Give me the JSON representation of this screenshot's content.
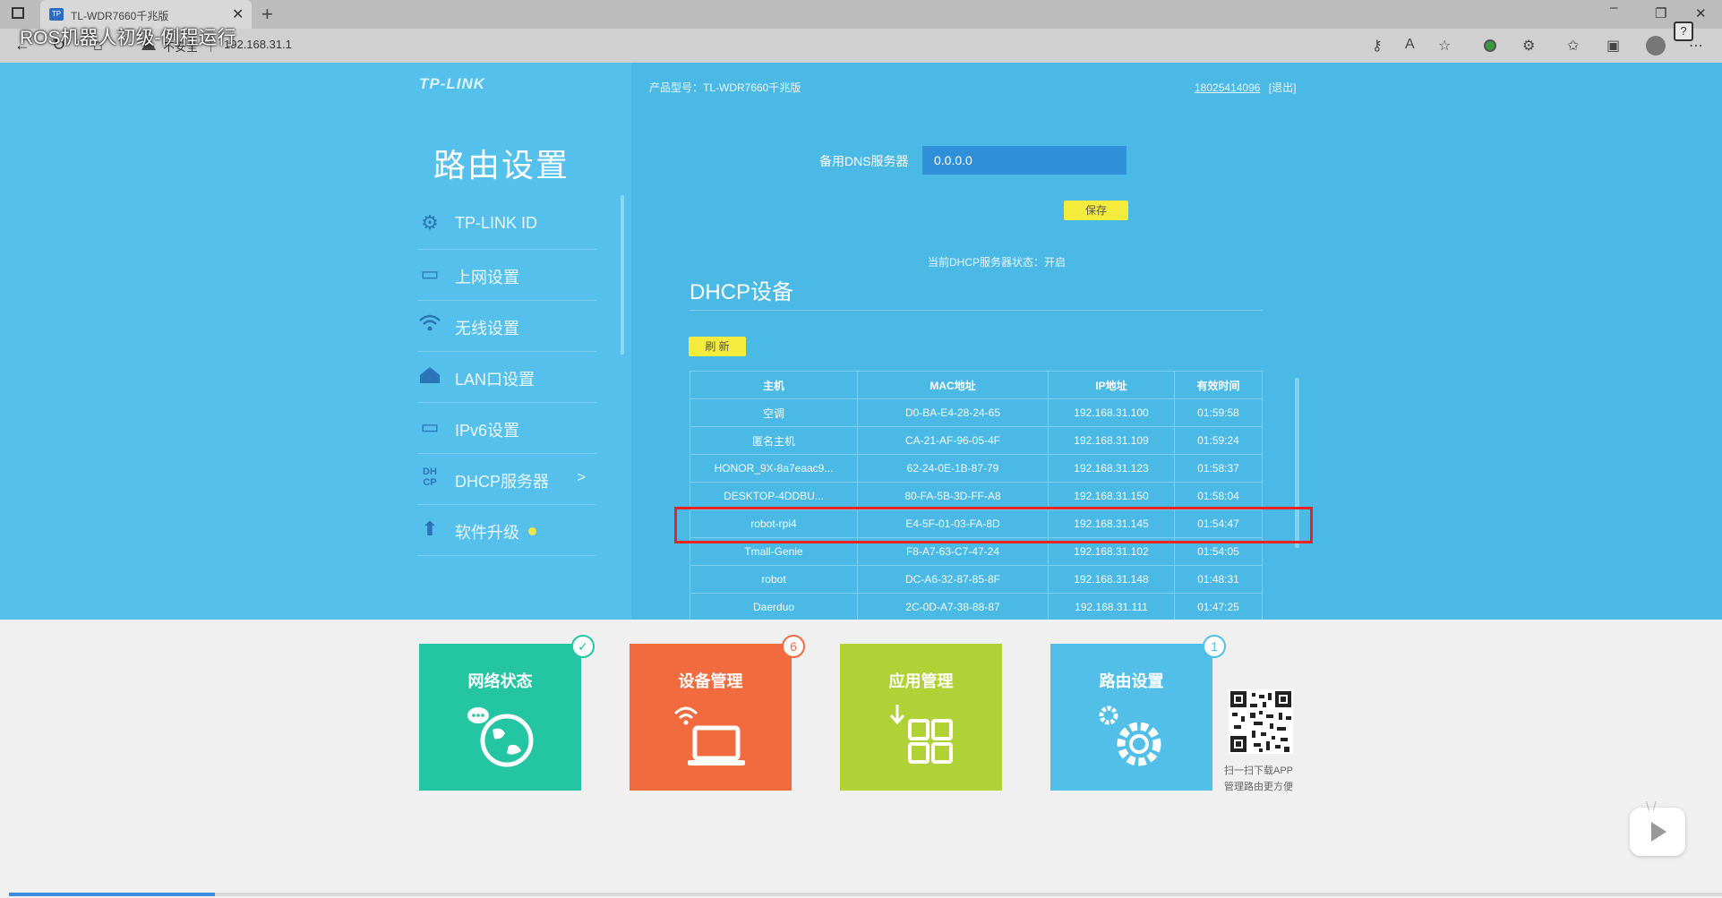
{
  "overlay_title": "ROS机器人初级-例程运行",
  "browser": {
    "tab_title": "TL-WDR7660千兆版",
    "tab_favicon": "TP",
    "tab_close": "✕",
    "new_tab": "+",
    "not_secure": "不安全",
    "url": "192.168.31.1",
    "help": "?"
  },
  "router": {
    "brand": "TP-LINK",
    "product_model": "产品型号：TL-WDR7660千兆版",
    "account": "18025414096",
    "logout": "[退出]",
    "section_title": "路由设置",
    "menu": [
      {
        "label": "TP-LINK ID",
        "icon": "gear-icon"
      },
      {
        "label": "上网设置",
        "icon": "monitor-icon"
      },
      {
        "label": "无线设置",
        "icon": "wifi-icon"
      },
      {
        "label": "LAN口设置",
        "icon": "house-icon"
      },
      {
        "label": "IPv6设置",
        "icon": "monitor-icon"
      },
      {
        "label": "DHCP服务器",
        "icon": "dhcp-icon",
        "icon_text": "DH CP",
        "arrow": ">"
      },
      {
        "label": "软件升级",
        "icon": "upload-icon"
      }
    ],
    "dns_label": "备用DNS服务器",
    "dns_value": "0.0.0.0",
    "save_label": "保存",
    "dhcp_status": "当前DHCP服务器状态：开启",
    "dhcp_title": "DHCP设备",
    "refresh_label": "刷 新",
    "table": {
      "headers": [
        "主机",
        "MAC地址",
        "IP地址",
        "有效时间"
      ],
      "rows": [
        [
          "空调",
          "D0-BA-E4-28-24-65",
          "192.168.31.100",
          "01:59:58"
        ],
        [
          "匿名主机",
          "CA-21-AF-96-05-4F",
          "192.168.31.109",
          "01:59:24"
        ],
        [
          "HONOR_9X-8a7eaac9...",
          "62-24-0E-1B-87-79",
          "192.168.31.123",
          "01:58:37"
        ],
        [
          "DESKTOP-4DDBU...",
          "80-FA-5B-3D-FF-A8",
          "192.168.31.150",
          "01:58:04"
        ],
        [
          "robot-rpi4",
          "E4-5F-01-03-FA-8D",
          "192.168.31.145",
          "01:54:47"
        ],
        [
          "Tmall-Genie",
          "F8-A7-63-C7-47-24",
          "192.168.31.102",
          "01:54:05"
        ],
        [
          "robot",
          "DC-A6-32-87-85-8F",
          "192.168.31.148",
          "01:48:31"
        ],
        [
          "Daerduo",
          "2C-0D-A7-38-88-87",
          "192.168.31.111",
          "01:47:25"
        ]
      ],
      "highlighted_row": 4
    }
  },
  "tiles": [
    {
      "label": "网络状态",
      "badge": "✓",
      "icon": "globe-icon",
      "color": "#24c5a2"
    },
    {
      "label": "设备管理",
      "badge": "6",
      "icon": "laptop-icon",
      "color": "#f26b3f"
    },
    {
      "label": "应用管理",
      "badge": "",
      "icon": "apps-grid-icon",
      "color": "#b0d236"
    },
    {
      "label": "路由设置",
      "badge": "1",
      "icon": "gears-icon",
      "color": "#51bfe7"
    }
  ],
  "qr": {
    "line1": "扫一扫下载APP",
    "line2": "管理路由更方便"
  },
  "video": {
    "progress": 0.12
  },
  "colors": {
    "router_bg": "#4ab9e6",
    "highlight": "#e82424",
    "button_yellow": "#f4ec3c"
  }
}
